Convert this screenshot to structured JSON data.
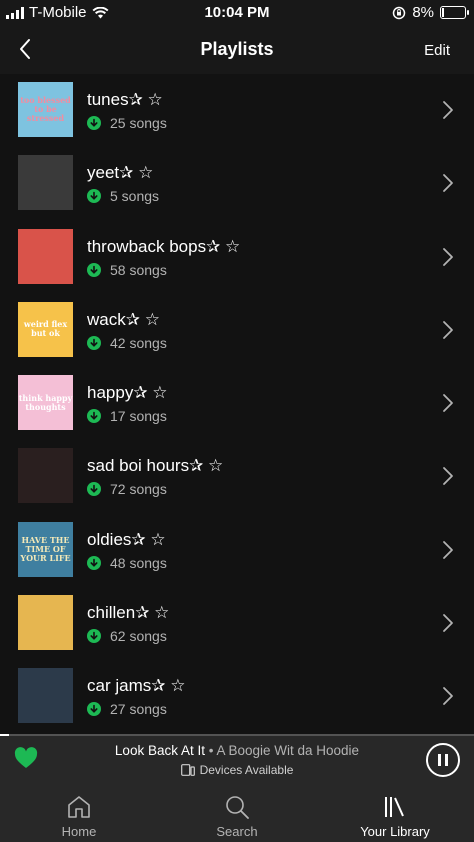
{
  "status_bar": {
    "carrier": "T-Mobile",
    "time": "10:04 PM",
    "battery": "8%"
  },
  "header": {
    "title": "Playlists",
    "edit_label": "Edit",
    "back_icon": "chevron-left-icon"
  },
  "playlists": [
    {
      "name": "tunes✰ ☆",
      "count": "25 songs",
      "art_text": "too blessed to be stressed",
      "art_bg": "#7ec3e0",
      "art_fg": "#f28ca0"
    },
    {
      "name": "yeet✰ ☆",
      "count": "5 songs",
      "art_text": "",
      "art_bg": "#3a3a3a",
      "art_fg": "#ffffff"
    },
    {
      "name": "throwback bops✰ ☆",
      "count": "58 songs",
      "art_text": "",
      "art_bg": "#d9534a",
      "art_fg": "#ffffff"
    },
    {
      "name": "wack✰ ☆",
      "count": "42 songs",
      "art_text": "weird flex but ok",
      "art_bg": "#f6c24a",
      "art_fg": "#ffffff"
    },
    {
      "name": "happy✰ ☆",
      "count": "17 songs",
      "art_text": "think happy thoughts",
      "art_bg": "#f4bfd6",
      "art_fg": "#ffffff"
    },
    {
      "name": "sad boi hours✰ ☆",
      "count": "72 songs",
      "art_text": "",
      "art_bg": "#2a1f1f",
      "art_fg": "#ff4d4d"
    },
    {
      "name": "oldies✰ ☆",
      "count": "48 songs",
      "art_text": "HAVE THE TIME OF YOUR LIFE",
      "art_bg": "#3f7fa0",
      "art_fg": "#f3e9b8"
    },
    {
      "name": "chillen✰ ☆",
      "count": "62 songs",
      "art_text": "",
      "art_bg": "#e6b650",
      "art_fg": "#2a2a2a"
    },
    {
      "name": "car jams✰ ☆",
      "count": "27 songs",
      "art_text": "",
      "art_bg": "#2c3a4a",
      "art_fg": "#f0d080"
    }
  ],
  "now_playing": {
    "title": "Look Back At It",
    "separator": " • ",
    "artist": "A Boogie Wit da Hoodie",
    "devices": "Devices Available",
    "progress": 0.02
  },
  "tabs": [
    {
      "label": "Home",
      "icon": "home-icon",
      "active": false
    },
    {
      "label": "Search",
      "icon": "search-icon",
      "active": false
    },
    {
      "label": "Your Library",
      "icon": "library-icon",
      "active": true
    }
  ],
  "colors": {
    "accent": "#1db954",
    "background": "#121212",
    "bar": "#181818",
    "player": "#282828"
  }
}
